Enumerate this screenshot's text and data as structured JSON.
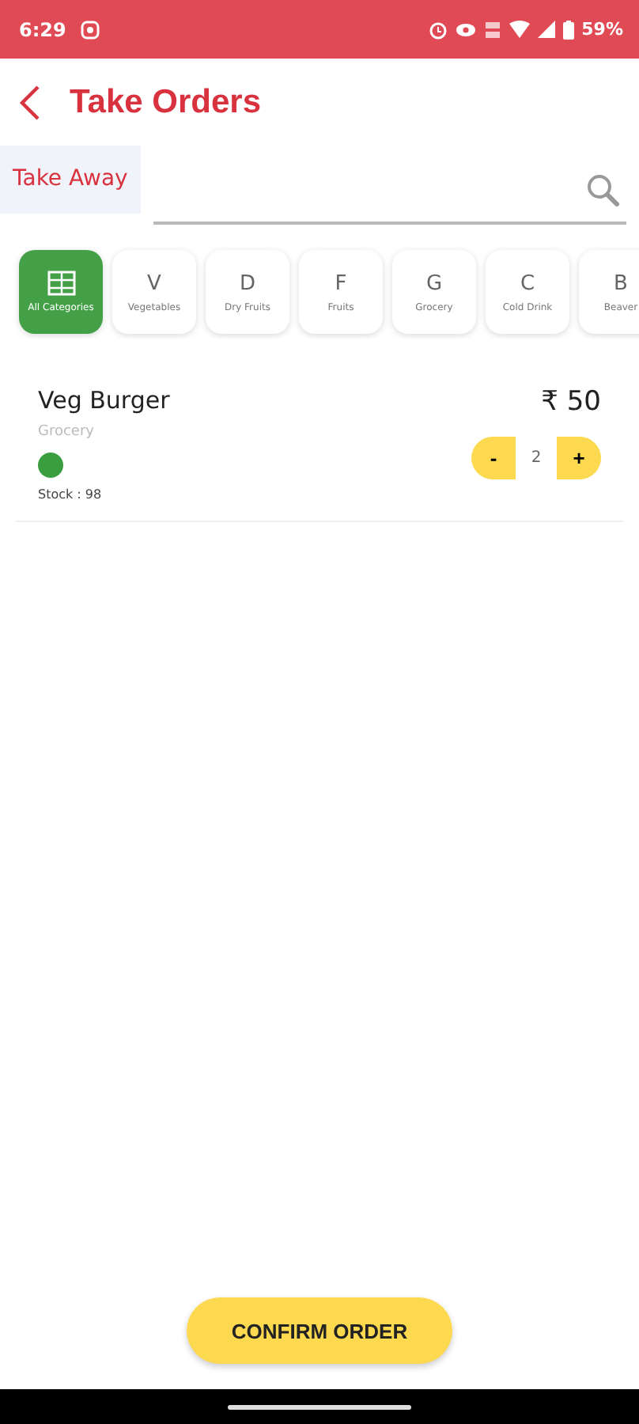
{
  "status_bar": {
    "time": "6:29",
    "battery": "59%"
  },
  "header": {
    "title": "Take Orders"
  },
  "order_type": {
    "label": "Take Away"
  },
  "categories": [
    {
      "kind": "icon",
      "label": "All Categories",
      "selected": true
    },
    {
      "kind": "letter",
      "letter": "V",
      "label": "Vegetables",
      "selected": false
    },
    {
      "kind": "letter",
      "letter": "D",
      "label": "Dry Fruits",
      "selected": false
    },
    {
      "kind": "letter",
      "letter": "F",
      "label": "Fruits",
      "selected": false
    },
    {
      "kind": "letter",
      "letter": "G",
      "label": "Grocery",
      "selected": false
    },
    {
      "kind": "letter",
      "letter": "C",
      "label": "Cold Drink",
      "selected": false
    },
    {
      "kind": "letter",
      "letter": "B",
      "label": "Beaver",
      "selected": false
    }
  ],
  "products": [
    {
      "name": "Veg Burger",
      "price": "₹ 50",
      "category": "Grocery",
      "color": "#3a9e3f",
      "stock": "Stock : 98",
      "decrement": "-",
      "quantity": "2",
      "increment": "+"
    }
  ],
  "confirm_button": "CONFIRM ORDER"
}
